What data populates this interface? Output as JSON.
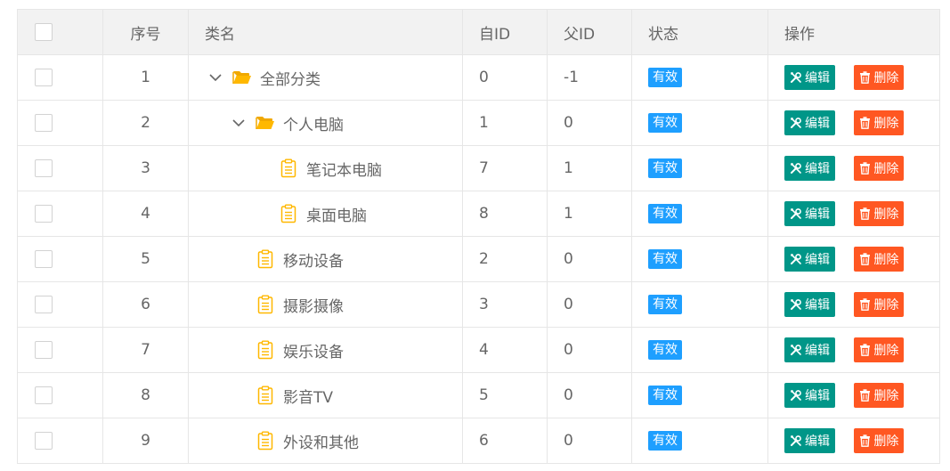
{
  "table": {
    "headers": {
      "index": "序号",
      "name": "类名",
      "self_id": "自ID",
      "parent_id": "父ID",
      "status": "状态",
      "ops": "操作"
    },
    "rows": [
      {
        "index": "1",
        "name": "全部分类",
        "self_id": "0",
        "parent_id": "-1",
        "status": "有效",
        "depth": 0,
        "type": "folder",
        "expanded": true
      },
      {
        "index": "2",
        "name": "个人电脑",
        "self_id": "1",
        "parent_id": "0",
        "status": "有效",
        "depth": 1,
        "type": "folder",
        "expanded": true
      },
      {
        "index": "3",
        "name": "笔记本电脑",
        "self_id": "7",
        "parent_id": "1",
        "status": "有效",
        "depth": 2,
        "type": "leaf"
      },
      {
        "index": "4",
        "name": "桌面电脑",
        "self_id": "8",
        "parent_id": "1",
        "status": "有效",
        "depth": 2,
        "type": "leaf"
      },
      {
        "index": "5",
        "name": "移动设备",
        "self_id": "2",
        "parent_id": "0",
        "status": "有效",
        "depth": 1,
        "type": "leaf"
      },
      {
        "index": "6",
        "name": "摄影摄像",
        "self_id": "3",
        "parent_id": "0",
        "status": "有效",
        "depth": 1,
        "type": "leaf"
      },
      {
        "index": "7",
        "name": "娱乐设备",
        "self_id": "4",
        "parent_id": "0",
        "status": "有效",
        "depth": 1,
        "type": "leaf"
      },
      {
        "index": "8",
        "name": "影音TV",
        "self_id": "5",
        "parent_id": "0",
        "status": "有效",
        "depth": 1,
        "type": "leaf"
      },
      {
        "index": "9",
        "name": "外设和其他",
        "self_id": "6",
        "parent_id": "0",
        "status": "有效",
        "depth": 1,
        "type": "leaf"
      }
    ]
  },
  "actions": {
    "edit_label": "编辑",
    "delete_label": "删除",
    "edit_icon": "wrench-screwdriver-icon",
    "delete_icon": "trash-icon"
  },
  "icons": {
    "folder": "folder-open-icon",
    "leaf": "clipboard-icon",
    "toggle": "chevron-down-icon"
  },
  "colors": {
    "folder": "#ffb800",
    "leaf": "#ffb800",
    "badge": "#1e9fff",
    "edit": "#009688",
    "delete": "#ff5722",
    "header_bg": "#f2f2f2",
    "border": "#e6e6e6"
  }
}
